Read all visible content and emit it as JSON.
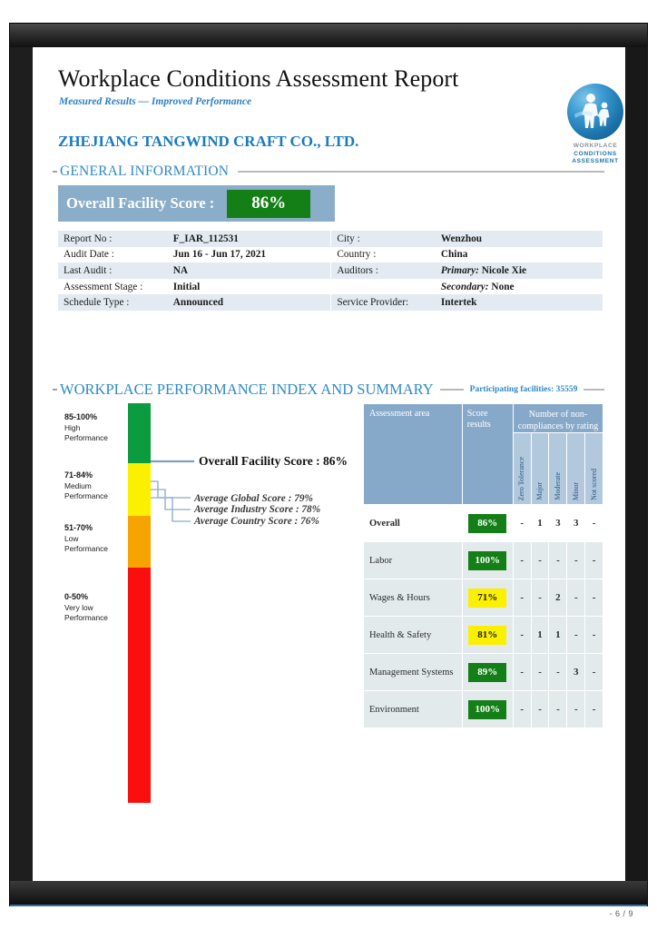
{
  "document": {
    "title": "Workplace Conditions Assessment Report",
    "tagline": "Measured Results — Improved Performance",
    "facility_name": "ZHEJIANG TANGWIND CRAFT CO., LTD.",
    "page_indicator": "- 6 / 9"
  },
  "logo": {
    "line1": "WORKPLACE",
    "line2": "CONDITIONS",
    "line3": "ASSESSMENT"
  },
  "sections": {
    "general_information": "GENERAL INFORMATION",
    "performance_index": "WORKPLACE PERFORMANCE INDEX AND SUMMARY",
    "participating_facilities": "Participating facilities: 35559"
  },
  "overall_score_banner": {
    "label": "Overall Facility Score :",
    "value": "86%"
  },
  "general_info": {
    "rows": [
      {
        "key": "Report No :",
        "value": "F_IAR_112531",
        "key2": "City :",
        "value2": "Wenzhou"
      },
      {
        "key": "Audit Date :",
        "value": "Jun 16 - Jun 17, 2021",
        "key2": "Country :",
        "value2": "China"
      },
      {
        "key": "Last Audit :",
        "value": "NA",
        "key2": "Auditors :",
        "value2_italic": "Primary:",
        "value2": "Nicole Xie"
      },
      {
        "key": "Assessment Stage :",
        "value": "Initial",
        "key2": "",
        "value2_italic": "Secondary:",
        "value2": "None"
      },
      {
        "key": "Schedule Type :",
        "value": "Announced",
        "key2": "Service Provider:",
        "value2": "Intertek"
      }
    ]
  },
  "performance_index": {
    "bands": [
      {
        "range": "85-100%",
        "label_line1": "High",
        "label_line2": "Performance",
        "color": "#0a9c3f"
      },
      {
        "range": "71-84%",
        "label_line1": "Medium",
        "label_line2": "Performance",
        "color": "#fbf000"
      },
      {
        "range": "51-70%",
        "label_line1": "Low",
        "label_line2": "Performance",
        "color": "#f7a300"
      },
      {
        "range": "0-50%",
        "label_line1": "Very low",
        "label_line2": "Performance",
        "color": "#fb0e0e"
      }
    ],
    "callouts": {
      "overall": "Overall Facility Score : 86%",
      "average_global": "Average Global Score : 79%",
      "average_industry": "Average Industry Score : 78%",
      "average_country": "Average Country Score : 76%"
    }
  },
  "summary_table": {
    "headers": {
      "assessment_area": "Assessment area",
      "score_results": "Score results",
      "non_compliances_group": "Number of non-compliances by rating",
      "rating_columns": [
        "Zero Tolerance",
        "Major",
        "Moderate",
        "Minor",
        "Not scored"
      ]
    },
    "rows": [
      {
        "area": "Overall",
        "score": "86%",
        "score_style": "green",
        "zero": "-",
        "major": "1",
        "moderate": "3",
        "minor": "3",
        "notscored": "-",
        "highlight": true
      },
      {
        "area": "Labor",
        "score": "100%",
        "score_style": "green",
        "zero": "-",
        "major": "-",
        "moderate": "-",
        "minor": "-",
        "notscored": "-",
        "highlight": false
      },
      {
        "area": "Wages & Hours",
        "score": "71%",
        "score_style": "yellow",
        "zero": "-",
        "major": "-",
        "moderate": "2",
        "minor": "-",
        "notscored": "-",
        "highlight": false
      },
      {
        "area": "Health & Safety",
        "score": "81%",
        "score_style": "yellow",
        "zero": "-",
        "major": "1",
        "moderate": "1",
        "minor": "-",
        "notscored": "-",
        "highlight": false
      },
      {
        "area": "Management Systems",
        "score": "89%",
        "score_style": "green",
        "zero": "-",
        "major": "-",
        "moderate": "-",
        "minor": "3",
        "notscored": "-",
        "highlight": false
      },
      {
        "area": "Environment",
        "score": "100%",
        "score_style": "green",
        "zero": "-",
        "major": "-",
        "moderate": "-",
        "minor": "-",
        "notscored": "-",
        "highlight": false
      }
    ]
  },
  "chart_data": {
    "type": "bar",
    "title": "Workplace Performance Index",
    "categories": [
      "Overall",
      "Labor",
      "Wages & Hours",
      "Health & Safety",
      "Management Systems",
      "Environment"
    ],
    "values": [
      86,
      100,
      71,
      81,
      89,
      100
    ],
    "ylabel": "Score results (%)",
    "ylim": [
      0,
      100
    ],
    "benchmarks": {
      "Average Global Score": 79,
      "Average Industry Score": 78,
      "Average Country Score": 76
    },
    "bands": [
      {
        "name": "High Performance",
        "min": 85,
        "max": 100,
        "color": "#0a9c3f"
      },
      {
        "name": "Medium Performance",
        "min": 71,
        "max": 84,
        "color": "#fbf000"
      },
      {
        "name": "Low Performance",
        "min": 51,
        "max": 70,
        "color": "#f7a300"
      },
      {
        "name": "Very low Performance",
        "min": 0,
        "max": 50,
        "color": "#fb0e0e"
      }
    ]
  },
  "colors": {
    "brand_blue": "#2e8ac9",
    "banner_blue": "#8aadc9",
    "table_header_blue": "#87a9c9",
    "score_green": "#137f16",
    "score_yellow": "#fbf000"
  }
}
